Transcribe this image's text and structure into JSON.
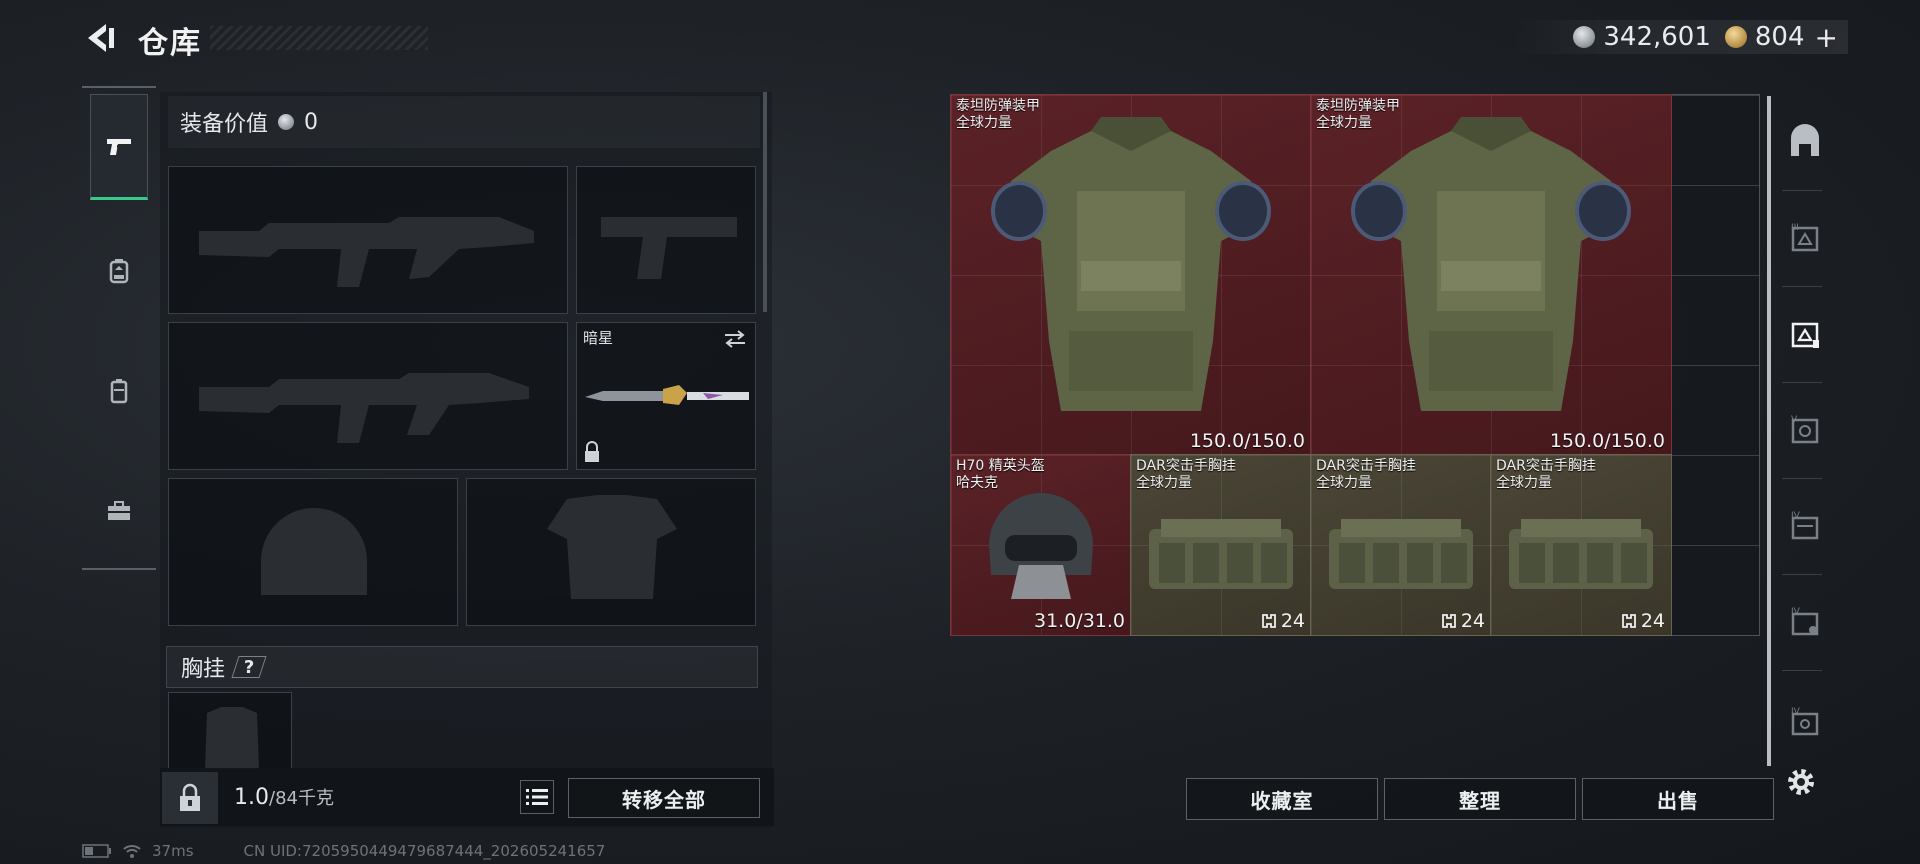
{
  "header": {
    "title": "仓库",
    "currency_silver": "342,601",
    "currency_gold": "804",
    "add_label": "+"
  },
  "equipment": {
    "value_label": "装备价值",
    "value": "0",
    "melee_name": "暗星",
    "chest_rig_label": "胸挂",
    "help_label": "?",
    "weight_current": "1.0",
    "weight_max": "/84千克",
    "transfer_all": "转移全部"
  },
  "stash": {
    "items": [
      {
        "name": "泰坦防弹装甲",
        "sub": "全球力量",
        "durability": "150.0/150.0"
      },
      {
        "name": "泰坦防弹装甲",
        "sub": "全球力量",
        "durability": "150.0/150.0"
      },
      {
        "name": "H70 精英头盔",
        "sub": "哈夫克",
        "durability": "31.0/31.0"
      },
      {
        "name": "DAR突击手胸挂",
        "sub": "全球力量",
        "capacity": "24"
      },
      {
        "name": "DAR突击手胸挂",
        "sub": "全球力量",
        "capacity": "24"
      },
      {
        "name": "DAR突击手胸挂",
        "sub": "全球力量",
        "capacity": "24"
      }
    ],
    "buttons": {
      "collection": "收藏室",
      "sort": "整理",
      "sell": "出售"
    }
  },
  "status": {
    "ping": "37ms",
    "uid": "CN UID:7205950449479687444_202605241657"
  },
  "colors": {
    "accent_green": "#39c98b",
    "armor_red": "#5b2227",
    "rig_olive": "#4b4636"
  },
  "icons": [
    "back-arrow-icon",
    "silver-coin-icon",
    "gold-coin-icon",
    "pistol-icon",
    "backpack-icon",
    "armor-rig-icon",
    "toolbox-icon",
    "lock-icon",
    "list-icon",
    "swap-icon",
    "gear-icon"
  ]
}
